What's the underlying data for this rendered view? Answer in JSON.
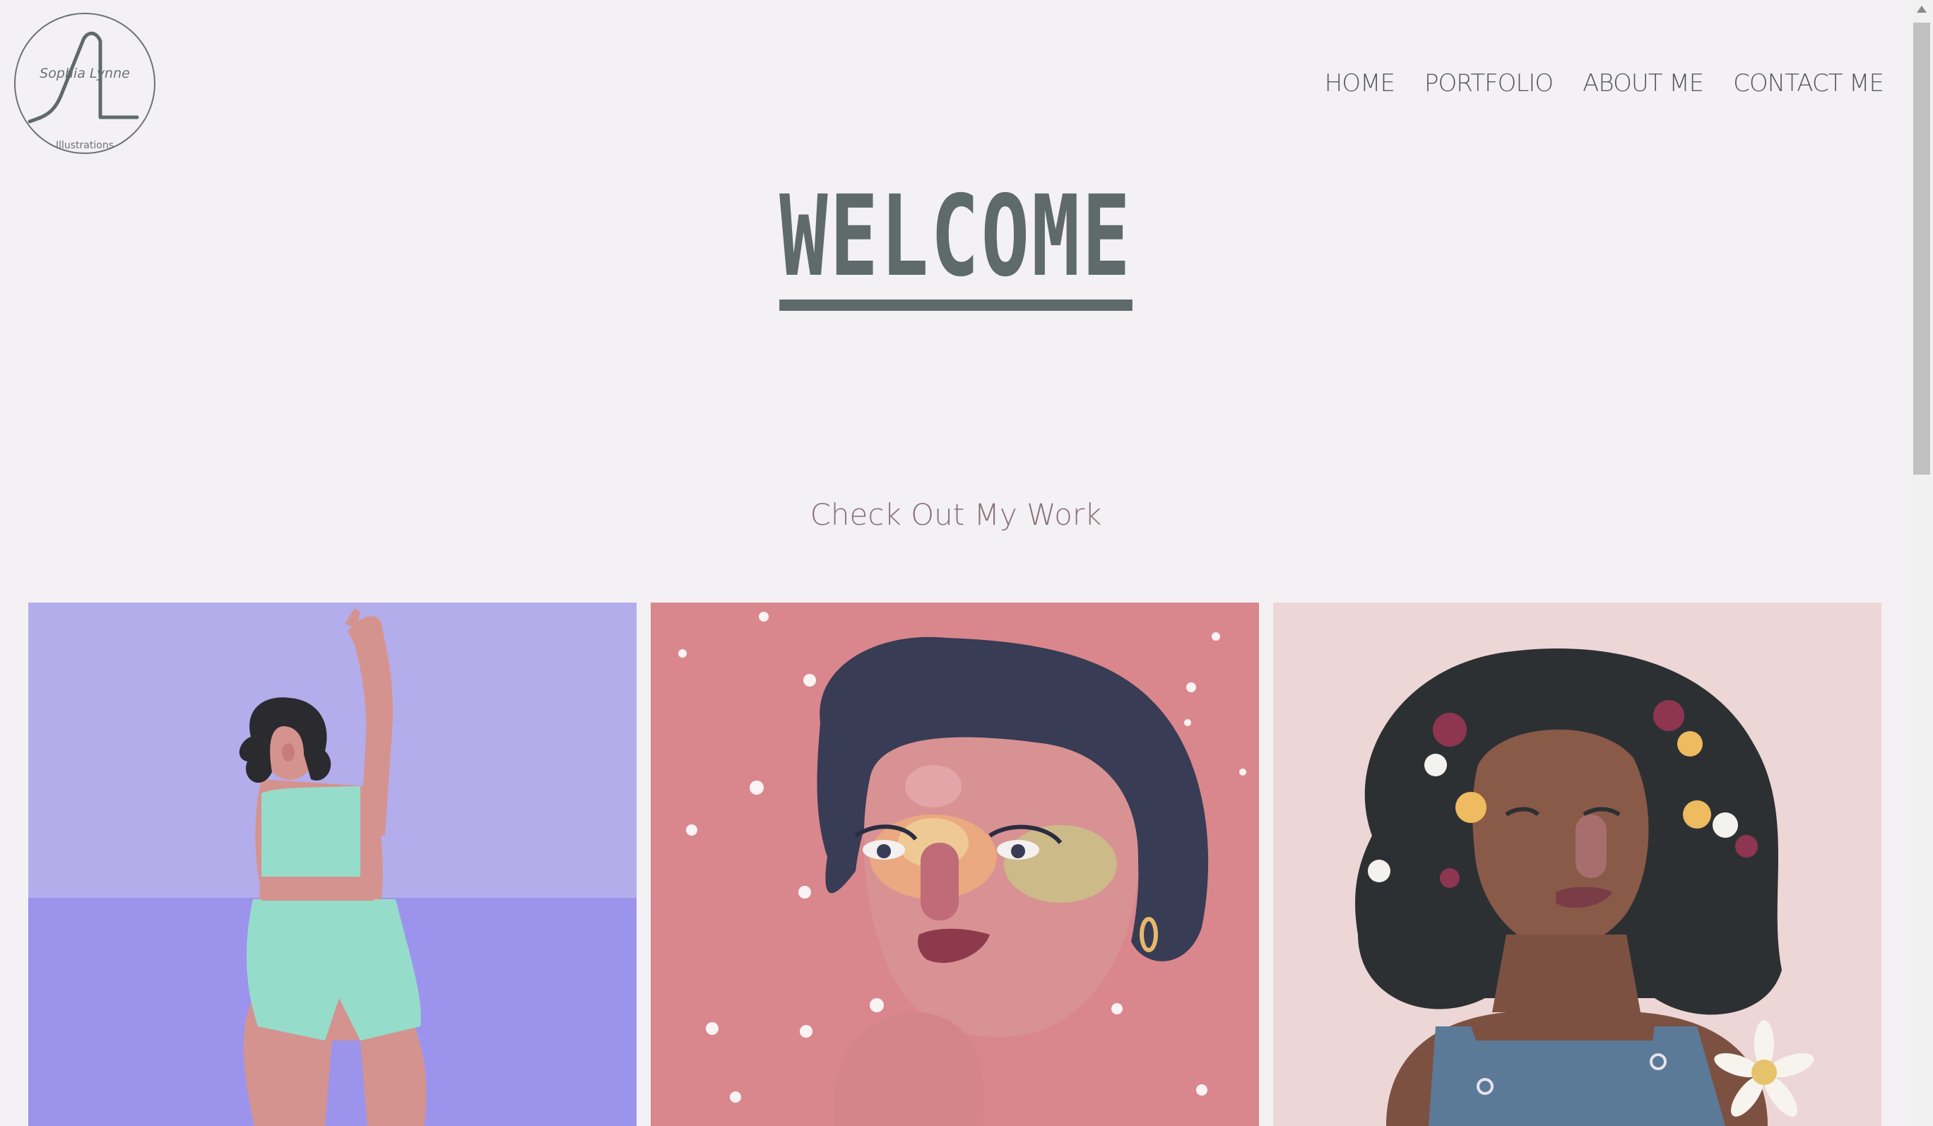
{
  "logo": {
    "name": "Sophia Lynne",
    "subtitle": "Illustrations",
    "initials": "SL"
  },
  "nav": {
    "items": [
      {
        "label": "HOME"
      },
      {
        "label": "PORTFOLIO"
      },
      {
        "label": "ABOUT ME"
      },
      {
        "label": "CONTACT ME"
      }
    ]
  },
  "hero": {
    "title": "WELCOME"
  },
  "section": {
    "subtitle": "Check Out My Work"
  },
  "gallery": {
    "items": [
      {
        "icon": "dancing-woman-illustration-icon"
      },
      {
        "icon": "galaxy-freckles-portrait-illustration-icon"
      },
      {
        "icon": "flower-hair-portrait-illustration-icon"
      }
    ]
  },
  "colors": {
    "background": "#f3f1f4",
    "nav_text": "#555a5c",
    "title": "#5f6a6b",
    "subtitle": "#8b7277",
    "tile1_sky": "#b4adec",
    "tile1_sea": "#9c94ec",
    "tile2_bg": "#d9878c",
    "tile3_bg": "#edd6d6"
  }
}
